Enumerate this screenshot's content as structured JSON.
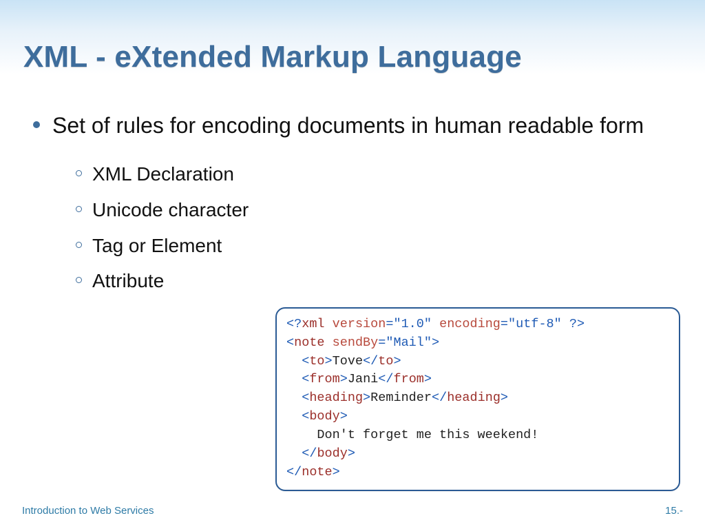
{
  "title": "XML - eXtended Markup Language",
  "main_bullet": "Set of rules for encoding documents in human readable form",
  "sub_bullets": [
    "XML Declaration",
    "Unicode character",
    "Tag or Element",
    "Attribute"
  ],
  "code": {
    "decl_open": "<?",
    "decl_xml": "xml",
    "decl_sp1": " ",
    "decl_a1": "version",
    "decl_eq": "=",
    "decl_v1": "\"1.0\"",
    "decl_sp2": " ",
    "decl_a2": "encoding",
    "decl_v2": "\"utf-8\"",
    "decl_close": " ?>",
    "note_open_lt": "<",
    "note_name": "note",
    "note_sp": " ",
    "note_attr": "sendBy",
    "note_val": "\"Mail\"",
    "gt": ">",
    "indent1": "  ",
    "indent2": "    ",
    "to_name": "to",
    "to_text": "Tove",
    "from_name": "from",
    "from_text": "Jani",
    "heading_name": "heading",
    "heading_text": "Reminder",
    "body_name": "body",
    "body_text": "Don't forget me this weekend!",
    "lt_close": "</"
  },
  "footer_left": "Introduction to Web Services",
  "footer_right": "15.-"
}
